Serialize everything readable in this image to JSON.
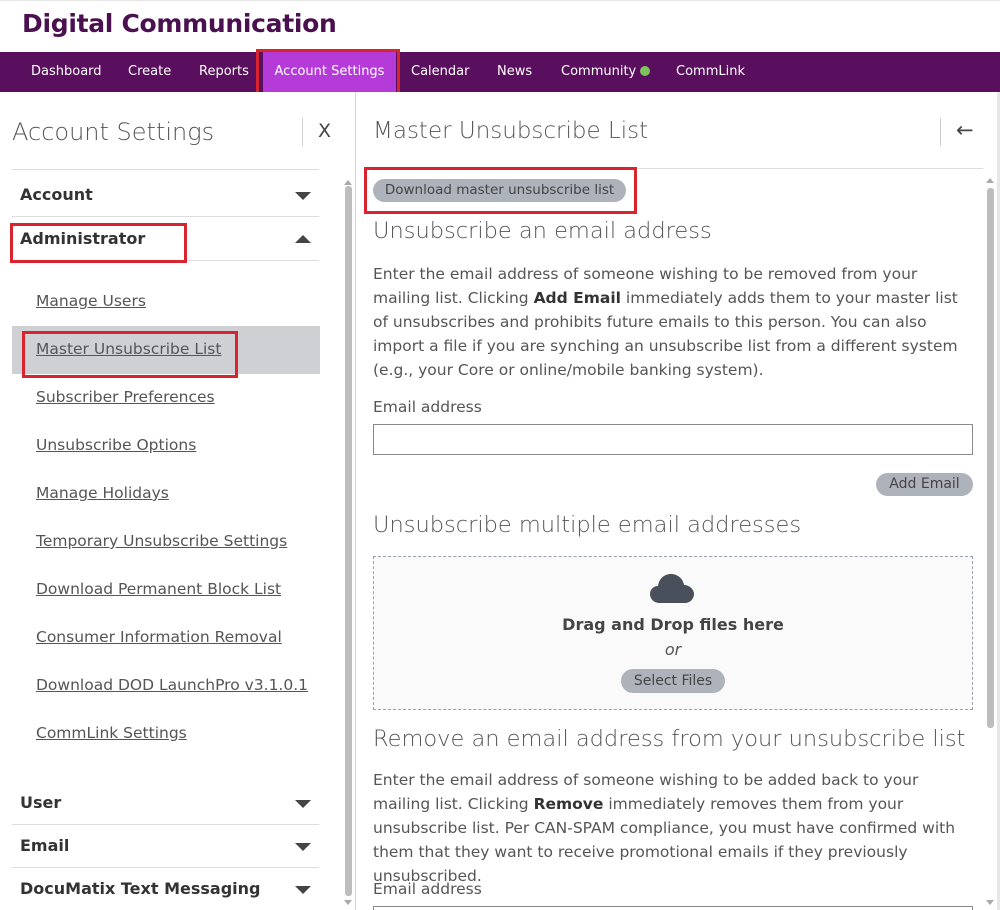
{
  "app": {
    "title": "Digital Communication"
  },
  "nav": {
    "items": [
      {
        "label": "Dashboard"
      },
      {
        "label": "Create"
      },
      {
        "label": "Reports"
      },
      {
        "label": "Account Settings"
      },
      {
        "label": "Calendar"
      },
      {
        "label": "News"
      },
      {
        "label": "Community"
      },
      {
        "label": "CommLink"
      }
    ],
    "active": "Account Settings",
    "community_status_color": "#7dc35b",
    "nav_bg": "#5a0f5e",
    "active_bg": "#b53bd8"
  },
  "sidebar": {
    "title": "Account Settings",
    "close_label": "X",
    "sections": {
      "account": {
        "label": "Account"
      },
      "administrator": {
        "label": "Administrator"
      },
      "user": {
        "label": "User"
      },
      "email": {
        "label": "Email"
      },
      "documatix": {
        "label": "DocuMatix Text Messaging"
      }
    },
    "admin_links": [
      {
        "label": "Manage Users"
      },
      {
        "label": "Master Unsubscribe List"
      },
      {
        "label": "Subscriber Preferences"
      },
      {
        "label": "Unsubscribe Options"
      },
      {
        "label": "Manage Holidays"
      },
      {
        "label": "Temporary Unsubscribe Settings"
      },
      {
        "label": "Download Permanent Block List"
      },
      {
        "label": "Consumer Information Removal"
      },
      {
        "label": "Download DOD LaunchPro v3.1.0.1"
      },
      {
        "label": "CommLink Settings"
      }
    ],
    "active_link": "Master Unsubscribe List"
  },
  "main": {
    "title": "Master Unsubscribe List",
    "download_button": "Download master unsubscribe list",
    "single": {
      "heading": "Unsubscribe an email address",
      "para_1": "Enter the email address of someone wishing to be removed from your mailing list. Clicking ",
      "para_bold": "Add Email",
      "para_2": " immediately adds them to your master list of unsubscribes and prohibits future emails to this person. You can also import a file if you are synching an unsubscribe list from a different system (e.g., your Core or online/mobile banking system).",
      "field_label": "Email address",
      "email_value": "",
      "add_button": "Add Email"
    },
    "multiple": {
      "heading": "Unsubscribe multiple email addresses",
      "drop_text": "Drag and Drop files here",
      "or_text": "or",
      "select_button": "Select Files"
    },
    "remove": {
      "heading": "Remove an email address from your unsubscribe list",
      "para_1": "Enter the email address of someone wishing to be added back to your mailing list. Clicking ",
      "para_bold": "Remove",
      "para_2": " immediately removes them from your unsubscribe list. Per CAN-SPAM compliance, you must have confirmed with them that they want to receive promotional emails if they previously unsubscribed.",
      "field_label": "Email address"
    }
  },
  "highlight_color": "#d9232e"
}
